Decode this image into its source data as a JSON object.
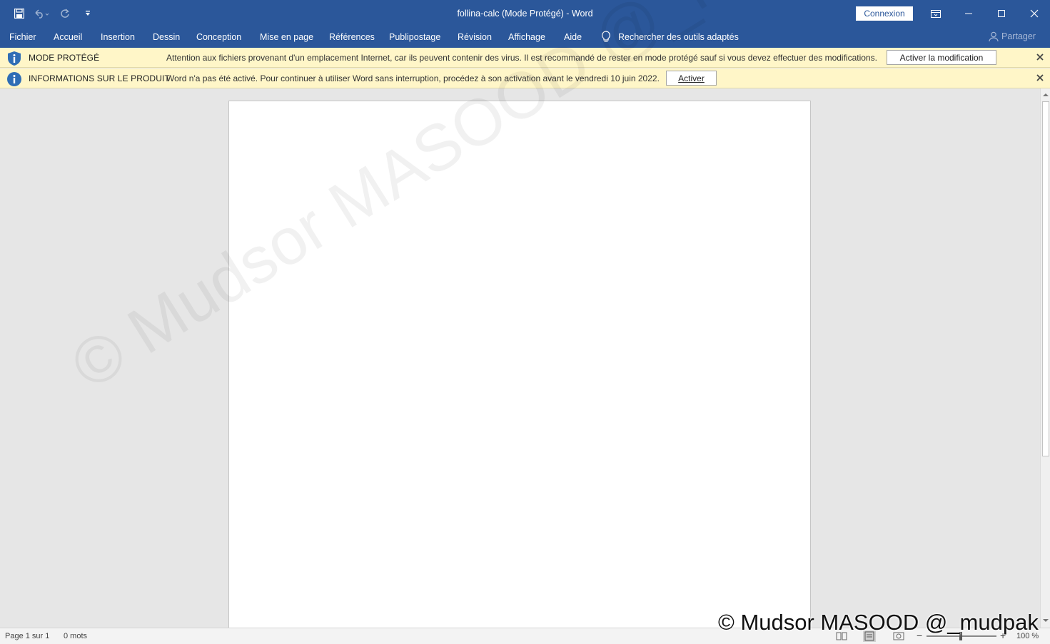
{
  "window": {
    "title": "follina-calc (Mode Protégé)  -  Word",
    "signin_label": "Connexion"
  },
  "ribbon": {
    "tabs": [
      "Fichier",
      "Accueil",
      "Insertion",
      "Dessin",
      "Conception",
      "Mise en page",
      "Références",
      "Publipostage",
      "Révision",
      "Affichage",
      "Aide"
    ],
    "tell_me": "Rechercher des outils adaptés",
    "share": "Partager"
  },
  "protected_bar": {
    "title": "MODE PROTÉGÉ",
    "message": "Attention aux fichiers provenant d'un emplacement Internet, car ils peuvent contenir des virus. Il est recommandé de rester en mode protégé sauf si vous devez effectuer des modifications.",
    "button": "Activer la modification"
  },
  "product_bar": {
    "title": "INFORMATIONS SUR LE PRODUIT",
    "message": "Word n'a pas été activé. Pour continuer à utiliser Word sans interruption, procédez à son activation avant le vendredi 10 juin 2022.",
    "button": "Activer"
  },
  "statusbar": {
    "page": "Page 1 sur 1",
    "words": "0 mots",
    "zoom": "100 %"
  },
  "watermark": {
    "diagonal": "© Mudsor MASOOD @_mudpak",
    "corner": "© Mudsor MASOOD @_mudpak"
  },
  "colors": {
    "ribbon": "#2b579a",
    "message_bar": "#fff6c8",
    "info_icon": "#2f6db5"
  },
  "icons": [
    "save-icon",
    "undo-icon",
    "redo-icon",
    "customize-qat-icon",
    "ribbon-display-icon",
    "minimize-icon",
    "maximize-icon",
    "close-icon",
    "lightbulb-icon",
    "person-icon",
    "info-icon"
  ]
}
